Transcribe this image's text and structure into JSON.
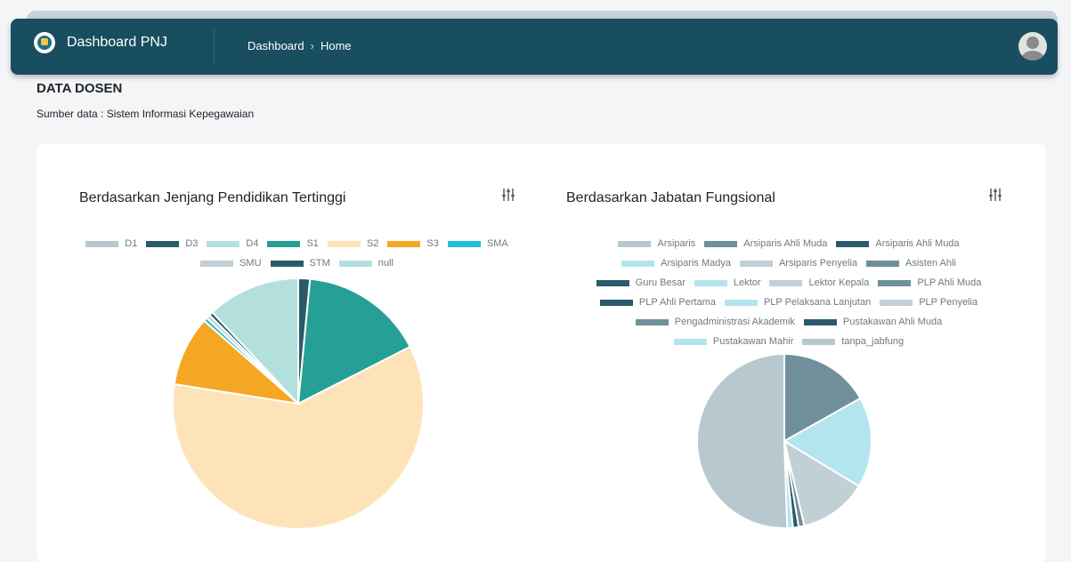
{
  "app": {
    "title": "Dashboard PNJ"
  },
  "breadcrumb": {
    "items": [
      "Dashboard",
      "Home"
    ],
    "separator": "›"
  },
  "page": {
    "title": "DATA DOSEN",
    "subtitle": "Sumber data : Sistem Informasi Kepegawaian"
  },
  "icons": {
    "logo": "pnj-logo",
    "filter": "sliders-icon",
    "user": "user-avatar-icon"
  },
  "colors": {
    "navbar": "#184e5f",
    "background": "#f3f5f7",
    "card": "#ffffff"
  },
  "chart_data": [
    {
      "type": "pie",
      "title": "Berdasarkan Jenjang Pendidikan Tertinggi",
      "legend_position": "top",
      "categories": [
        "D1",
        "D3",
        "D4",
        "S1",
        "S2",
        "S3",
        "SMA",
        "SMU",
        "STM",
        "null"
      ],
      "values": [
        0,
        1.5,
        0,
        16,
        60,
        9,
        0.5,
        0.5,
        0.5,
        12
      ],
      "colors": [
        "#b8c8cf",
        "#2b5a6a",
        "#b3e0dc",
        "#26a096",
        "#fde3b7",
        "#f5a623",
        "#22c1d9",
        "#c2cfd4",
        "#2b5a6a",
        "#b3e0dc"
      ]
    },
    {
      "type": "pie",
      "title": "Berdasarkan Jabatan Fungsional",
      "legend_position": "top",
      "categories": [
        "Arsiparis",
        "Arsiparis Ahli Muda",
        "Arsiparis Ahli Muda",
        "Arsiparis Madya",
        "Arsiparis Penyelia",
        "Asisten Ahli",
        "Guru Besar",
        "Lektor",
        "Lektor Kepala",
        "PLP Ahli Muda",
        "PLP Ahli Pertama",
        "PLP Pelaksana Lanjutan",
        "PLP Penyelia",
        "Pengadministrasi Akademik",
        "Pustakawan Ahli Muda",
        "Pustakawan Mahir",
        "tanpa_jabfung"
      ],
      "values": [
        0,
        0,
        0,
        0,
        0,
        16,
        0,
        16,
        12,
        0,
        0,
        0,
        0,
        1,
        1,
        1,
        48
      ],
      "colors": [
        "#b8c8cf",
        "#6f8f9b",
        "#2b5a6a",
        "#b3e5ef",
        "#c2cfd4",
        "#6f8f9b",
        "#2b5a6a",
        "#b3e5ef",
        "#c2cfd4",
        "#6f8f9b",
        "#2b5a6a",
        "#b3e5ef",
        "#c2cfd4",
        "#6f8f9b",
        "#2b5a6a",
        "#b3e5ef",
        "#b8c8cf"
      ]
    }
  ]
}
